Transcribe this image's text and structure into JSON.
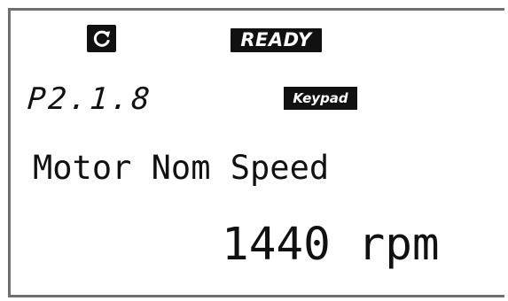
{
  "status": {
    "run_icon": "rotate-clockwise-icon",
    "state_label": "READY"
  },
  "parameter": {
    "code": "P2.1.8",
    "control_place": "Keypad",
    "name": "Motor Nom Speed",
    "value": "1440 rpm"
  },
  "colors": {
    "display_background": "#ffffff",
    "text": "#111111",
    "frame": "#6f6f6f"
  }
}
